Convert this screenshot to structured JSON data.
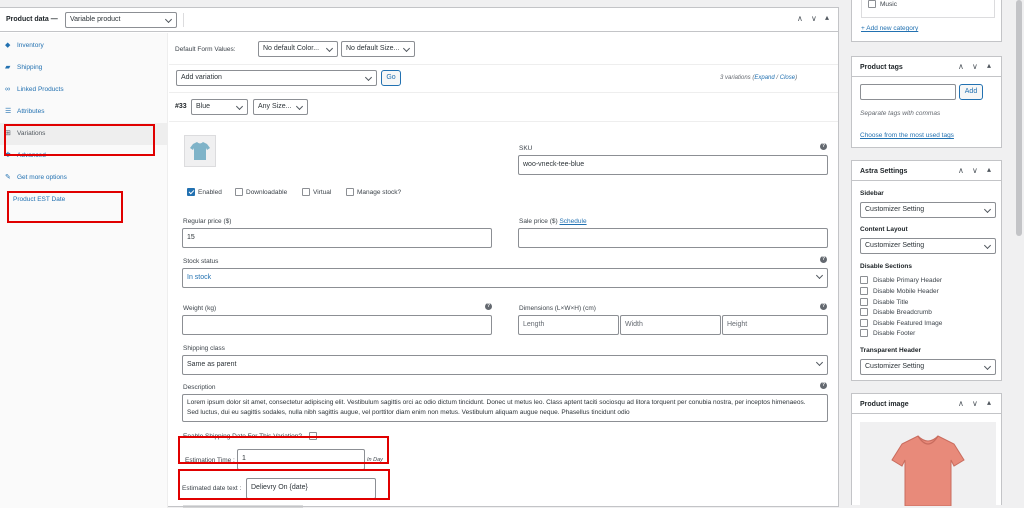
{
  "product_data": {
    "title": "Product data —",
    "type_select": "Variable product",
    "tabs": [
      {
        "label": "Inventory",
        "icon": "inventory-icon"
      },
      {
        "label": "Shipping",
        "icon": "truck-icon"
      },
      {
        "label": "Linked Products",
        "icon": "link-icon"
      },
      {
        "label": "Attributes",
        "icon": "list-icon"
      },
      {
        "label": "Variations",
        "icon": "grid-icon"
      },
      {
        "label": "Advanced",
        "icon": "gear-icon"
      },
      {
        "label": "Get more options",
        "icon": "plugin-icon"
      },
      {
        "label": "Product EST Date",
        "icon": ""
      }
    ]
  },
  "variations": {
    "default_form_label": "Default Form Values:",
    "default_color": "No default Color...",
    "default_size": "No default Size...",
    "add_variation": "Add variation",
    "go_label": "Go",
    "count_text": "3 variations",
    "expand_label": "Expand",
    "sep": "/",
    "close_label": "Close",
    "variation_id": "#33",
    "color_value": "Blue",
    "size_value": "Any Size...",
    "sku_label": "SKU",
    "sku_value": "woo-vneck-tee-blue",
    "enabled_label": "Enabled",
    "downloadable_label": "Downloadable",
    "virtual_label": "Virtual",
    "manage_stock_label": "Manage stock?",
    "regular_price_label": "Regular price ($)",
    "regular_price_value": "15",
    "sale_price_label": "Sale price ($)",
    "schedule_label": "Schedule",
    "stock_status_label": "Stock status",
    "stock_status_value": "In stock",
    "weight_label": "Weight (kg)",
    "dimensions_label": "Dimensions (L×W×H) (cm)",
    "length_ph": "Length",
    "width_ph": "Width",
    "height_ph": "Height",
    "shipping_class_label": "Shipping class",
    "shipping_class_value": "Same as parent",
    "description_label": "Description",
    "description_text": "Lorem ipsum dolor sit amet, consectetur adipiscing elit. Vestibulum sagittis orci ac odio dictum tincidunt. Donec ut metus leo. Class aptent taciti sociosqu ad litora torquent per conubia nostra, per inceptos himenaeos. Sed luctus, dui eu sagittis sodales, nulla nibh sagittis augue, vel porttitor diam enim non metus. Vestibulum aliquam augue neque. Phasellus tincidunt odio",
    "enable_shipping_label": "Enable Shipping Date For This Variation?",
    "estimation_label": "Estimation Time :",
    "estimation_value": "1",
    "estimation_unit": "In Day",
    "est_text_label": "Estimated date text :",
    "est_text_value": "Delievry On {date}"
  },
  "sidebar": {
    "category_music": "Music",
    "add_category": "+ Add new category",
    "tags_title": "Product tags",
    "add_btn": "Add",
    "tags_help": "Separate tags with commas",
    "tags_link": "Choose from the most used tags",
    "astra_title": "Astra Settings",
    "sidebar_label": "Sidebar",
    "sidebar_value": "Customizer Setting",
    "content_layout_label": "Content Layout",
    "content_layout_value": "Customizer Setting",
    "disable_sections_label": "Disable Sections",
    "disable_items": [
      "Disable Primary Header",
      "Disable Mobile Header",
      "Disable Title",
      "Disable Breadcrumb",
      "Disable Featured Image",
      "Disable Footer"
    ],
    "transparent_header_label": "Transparent Header",
    "transparent_header_value": "Customizer Setting",
    "product_image_title": "Product image"
  },
  "colors": {
    "accent": "#2271b1",
    "highlight": "#e00000"
  }
}
